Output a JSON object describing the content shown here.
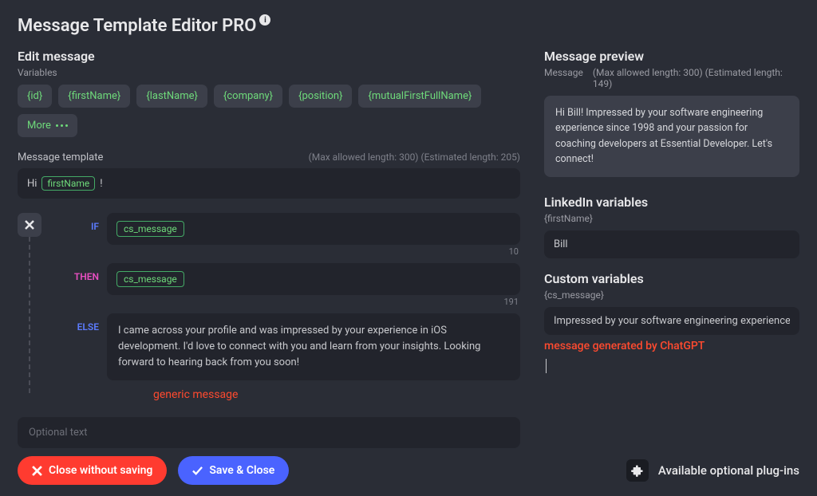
{
  "header": {
    "title": "Message Template Editor PRO",
    "info_icon": "i"
  },
  "left": {
    "edit_heading": "Edit message",
    "variables_label": "Variables",
    "chips": [
      "{id}",
      "{firstName}",
      "{lastName}",
      "{company}",
      "{position}",
      "{mutualFirstFullName}"
    ],
    "more_label": "More",
    "template_label": "Message template",
    "template_meta": "(Max allowed length: 300) (Estimated length: 205)",
    "greeting_prefix": "Hi",
    "greeting_var": "firstName",
    "greeting_suffix": "!",
    "if_kw": "IF",
    "if_var": "cs_message",
    "if_count": "10",
    "then_kw": "THEN",
    "then_var": "cs_message",
    "then_count": "191",
    "else_kw": "ELSE",
    "else_text": "I came across your profile and was impressed by your experience in iOS development. I'd love to connect with you and learn from your insights. Looking forward to hearing back from you soon!",
    "generic_annotation": "generic message",
    "optional_placeholder": "Optional text"
  },
  "right": {
    "preview_heading": "Message preview",
    "preview_label": "Message",
    "preview_meta": "(Max allowed length: 300) (Estimated length: 149)",
    "preview_text": "Hi Bill! Impressed by your software engineering experience since 1998 and your passion for coaching developers at Essential Developer. Let's connect!",
    "linkedin_heading": "LinkedIn variables",
    "linkedin_var_label": "{firstName}",
    "linkedin_value": "Bill",
    "custom_heading": "Custom variables",
    "custom_var_label": "{cs_message}",
    "custom_value": "Impressed by your software engineering experience since",
    "chatgpt_note": "message generated by ChatGPT"
  },
  "footer": {
    "close_label": "Close without saving",
    "save_label": "Save & Close",
    "plugins_label": "Available optional plug-ins"
  }
}
